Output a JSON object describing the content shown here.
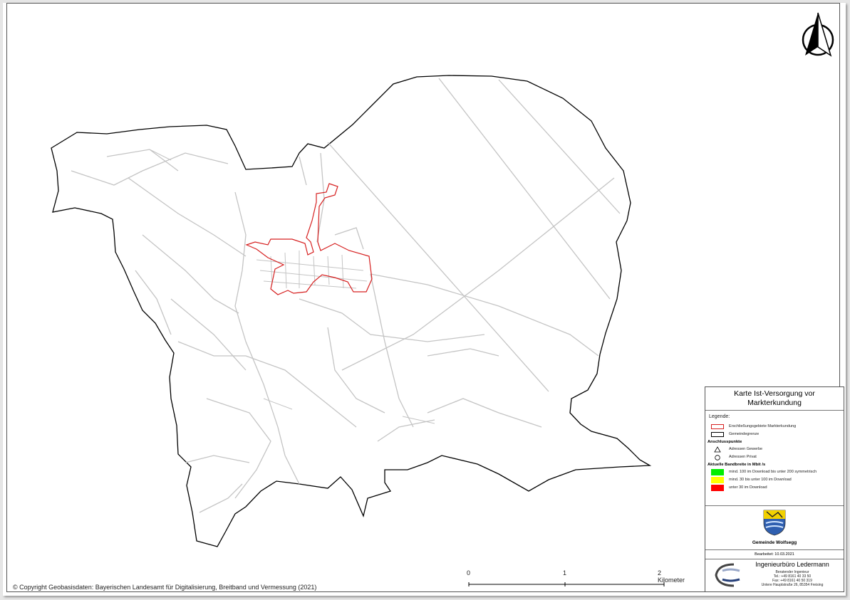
{
  "map": {
    "colors": {
      "boundary": "#000000",
      "roads": "#c4c4c4",
      "area_outline": "#d62020"
    }
  },
  "legend": {
    "title_line1": "Karte Ist-Versorgung vor",
    "title_line2": "Markterkundung",
    "legend_heading": "Legende:",
    "item_area": "Erschließungsgebiete Markterkundung",
    "item_boundary": "Gemeindegrenze",
    "points_heading": "Anschlusspunkte",
    "item_business": "Adressen Gewerbe",
    "item_private": "Adressen Privat",
    "bandwidth_heading": "Aktuelle Bandbreite in Mbit /s",
    "bw_green": "mind. 100 im Download bis unter 200 symmetrisch",
    "bw_yellow": "mind. 30 bis unter 100 im Download",
    "bw_red": "unter 30 im Download",
    "colors": {
      "green": "#00ee00",
      "yellow": "#ffff00",
      "red": "#ff0000"
    },
    "municipality": "Gemeinde Wolfsegg",
    "edited": "Bearbeitet: 10.03.2021"
  },
  "firm": {
    "name": "Ingenieurbüro Ledermann",
    "line1": "Beratender Ingenieur",
    "line2": "Tel.: +49 8161 40 33 50",
    "line3": "Fax: +49 8161 40 50 319",
    "line4": "Untere Hauptstraße 26, 85354 Freising"
  },
  "scale": {
    "label0": "0",
    "label1": "1",
    "label2": "2 Kilometer"
  },
  "copyright": "© Copyright Geobasisdaten: Bayerischen Landesamt für Digitalisierung, Breitband und Vermessung (2021)"
}
